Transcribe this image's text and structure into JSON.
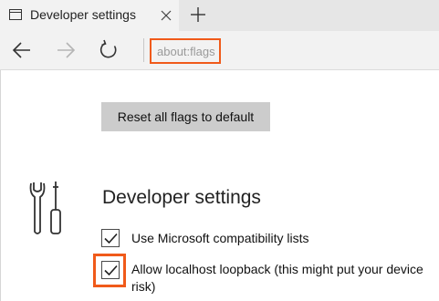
{
  "tab": {
    "title": "Developer settings",
    "icon": "window-icon"
  },
  "toolbar": {
    "address": "about:flags"
  },
  "content": {
    "reset_label": "Reset all flags to default",
    "section_title": "Developer settings",
    "checkboxes": [
      {
        "label": "Use Microsoft compatibility lists",
        "checked": true
      },
      {
        "label": "Allow localhost loopback (this might put your device",
        "label_cont": "risk)",
        "checked": true
      }
    ]
  },
  "colors": {
    "highlight": "#f05a1a",
    "button_bg": "#cccccc",
    "tab_bar": "#e6e6e6"
  }
}
